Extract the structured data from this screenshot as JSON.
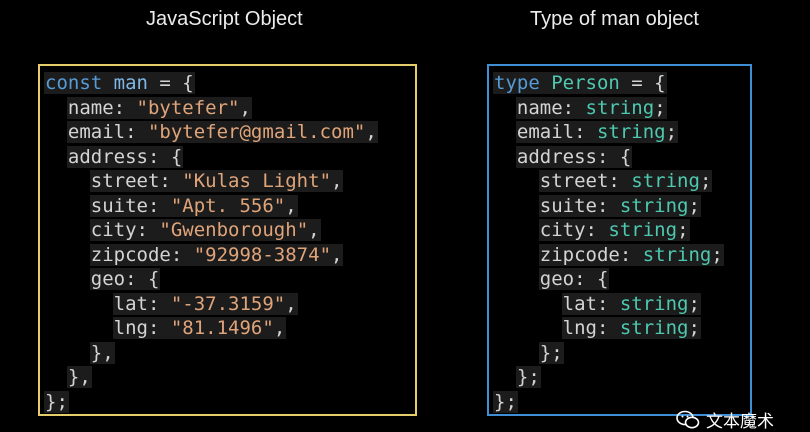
{
  "left": {
    "title": "JavaScript Object",
    "border_color": "#e5cd6b",
    "lines": [
      {
        "indent": 0,
        "parts": [
          {
            "t": "kw",
            "v": "const"
          },
          {
            "t": "punc",
            "v": " "
          },
          {
            "t": "ident",
            "v": "man"
          },
          {
            "t": "punc",
            "v": " = {"
          }
        ]
      },
      {
        "indent": 1,
        "parts": [
          {
            "t": "key",
            "v": "name"
          },
          {
            "t": "punc",
            "v": ": "
          },
          {
            "t": "str",
            "v": "\"bytefer\""
          },
          {
            "t": "punc",
            "v": ","
          }
        ]
      },
      {
        "indent": 1,
        "parts": [
          {
            "t": "key",
            "v": "email"
          },
          {
            "t": "punc",
            "v": ": "
          },
          {
            "t": "str",
            "v": "\"bytefer@gmail.com\""
          },
          {
            "t": "punc",
            "v": ","
          }
        ]
      },
      {
        "indent": 1,
        "parts": [
          {
            "t": "key",
            "v": "address"
          },
          {
            "t": "punc",
            "v": ": {"
          }
        ]
      },
      {
        "indent": 2,
        "parts": [
          {
            "t": "key",
            "v": "street"
          },
          {
            "t": "punc",
            "v": ": "
          },
          {
            "t": "str",
            "v": "\"Kulas Light\""
          },
          {
            "t": "punc",
            "v": ","
          }
        ]
      },
      {
        "indent": 2,
        "parts": [
          {
            "t": "key",
            "v": "suite"
          },
          {
            "t": "punc",
            "v": ": "
          },
          {
            "t": "str",
            "v": "\"Apt. 556\""
          },
          {
            "t": "punc",
            "v": ","
          }
        ]
      },
      {
        "indent": 2,
        "parts": [
          {
            "t": "key",
            "v": "city"
          },
          {
            "t": "punc",
            "v": ": "
          },
          {
            "t": "str",
            "v": "\"Gwenborough\""
          },
          {
            "t": "punc",
            "v": ","
          }
        ]
      },
      {
        "indent": 2,
        "parts": [
          {
            "t": "key",
            "v": "zipcode"
          },
          {
            "t": "punc",
            "v": ": "
          },
          {
            "t": "str",
            "v": "\"92998-3874\""
          },
          {
            "t": "punc",
            "v": ","
          }
        ]
      },
      {
        "indent": 2,
        "parts": [
          {
            "t": "key",
            "v": "geo"
          },
          {
            "t": "punc",
            "v": ": {"
          }
        ]
      },
      {
        "indent": 3,
        "parts": [
          {
            "t": "key",
            "v": "lat"
          },
          {
            "t": "punc",
            "v": ": "
          },
          {
            "t": "str",
            "v": "\"-37.3159\""
          },
          {
            "t": "punc",
            "v": ","
          }
        ]
      },
      {
        "indent": 3,
        "parts": [
          {
            "t": "key",
            "v": "lng"
          },
          {
            "t": "punc",
            "v": ": "
          },
          {
            "t": "str",
            "v": "\"81.1496\""
          },
          {
            "t": "punc",
            "v": ","
          }
        ]
      },
      {
        "indent": 2,
        "parts": [
          {
            "t": "punc",
            "v": "},"
          }
        ]
      },
      {
        "indent": 1,
        "parts": [
          {
            "t": "punc",
            "v": "},"
          }
        ]
      },
      {
        "indent": 0,
        "parts": [
          {
            "t": "punc",
            "v": "};"
          }
        ]
      }
    ]
  },
  "right": {
    "title": "Type of man object",
    "border_color": "#3f8fd6",
    "lines": [
      {
        "indent": 0,
        "parts": [
          {
            "t": "kw",
            "v": "type"
          },
          {
            "t": "punc",
            "v": " "
          },
          {
            "t": "type",
            "v": "Person"
          },
          {
            "t": "punc",
            "v": " = {"
          }
        ]
      },
      {
        "indent": 1,
        "parts": [
          {
            "t": "key",
            "v": "name"
          },
          {
            "t": "punc",
            "v": ": "
          },
          {
            "t": "type",
            "v": "string"
          },
          {
            "t": "punc",
            "v": ";"
          }
        ]
      },
      {
        "indent": 1,
        "parts": [
          {
            "t": "key",
            "v": "email"
          },
          {
            "t": "punc",
            "v": ": "
          },
          {
            "t": "type",
            "v": "string"
          },
          {
            "t": "punc",
            "v": ";"
          }
        ]
      },
      {
        "indent": 1,
        "parts": [
          {
            "t": "key",
            "v": "address"
          },
          {
            "t": "punc",
            "v": ": {"
          }
        ]
      },
      {
        "indent": 2,
        "parts": [
          {
            "t": "key",
            "v": "street"
          },
          {
            "t": "punc",
            "v": ": "
          },
          {
            "t": "type",
            "v": "string"
          },
          {
            "t": "punc",
            "v": ";"
          }
        ]
      },
      {
        "indent": 2,
        "parts": [
          {
            "t": "key",
            "v": "suite"
          },
          {
            "t": "punc",
            "v": ": "
          },
          {
            "t": "type",
            "v": "string"
          },
          {
            "t": "punc",
            "v": ";"
          }
        ]
      },
      {
        "indent": 2,
        "parts": [
          {
            "t": "key",
            "v": "city"
          },
          {
            "t": "punc",
            "v": ": "
          },
          {
            "t": "type",
            "v": "string"
          },
          {
            "t": "punc",
            "v": ";"
          }
        ]
      },
      {
        "indent": 2,
        "parts": [
          {
            "t": "key",
            "v": "zipcode"
          },
          {
            "t": "punc",
            "v": ": "
          },
          {
            "t": "type",
            "v": "string"
          },
          {
            "t": "punc",
            "v": ";"
          }
        ]
      },
      {
        "indent": 2,
        "parts": [
          {
            "t": "key",
            "v": "geo"
          },
          {
            "t": "punc",
            "v": ": {"
          }
        ]
      },
      {
        "indent": 3,
        "parts": [
          {
            "t": "key",
            "v": "lat"
          },
          {
            "t": "punc",
            "v": ": "
          },
          {
            "t": "type",
            "v": "string"
          },
          {
            "t": "punc",
            "v": ";"
          }
        ]
      },
      {
        "indent": 3,
        "parts": [
          {
            "t": "key",
            "v": "lng"
          },
          {
            "t": "punc",
            "v": ": "
          },
          {
            "t": "type",
            "v": "string"
          },
          {
            "t": "punc",
            "v": ";"
          }
        ]
      },
      {
        "indent": 2,
        "parts": [
          {
            "t": "punc",
            "v": "};"
          }
        ]
      },
      {
        "indent": 1,
        "parts": [
          {
            "t": "punc",
            "v": "};"
          }
        ]
      },
      {
        "indent": 0,
        "parts": [
          {
            "t": "punc",
            "v": "};"
          }
        ]
      }
    ]
  },
  "colors": {
    "kw": "#569cd6",
    "ident": "#7fb8e6",
    "key": "#d4d4d4",
    "punc": "#d4d4d4",
    "str": "#e0a47a",
    "type": "#4ec9b0"
  },
  "watermark": {
    "icon": "wechat-icon",
    "text": "文本魔术"
  }
}
